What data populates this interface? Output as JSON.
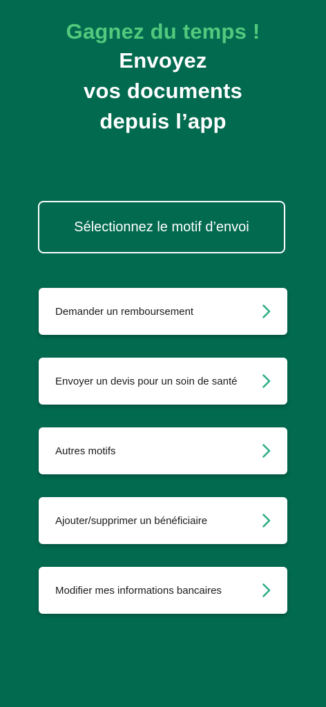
{
  "hero": {
    "accent": "Gagnez du temps !",
    "line1": "Envoyez",
    "line2": "vos documents",
    "line3": "depuis l’app"
  },
  "motif": {
    "label": "Sélectionnez le motif d’envoi"
  },
  "options": [
    {
      "label": "Demander un remboursement",
      "icon": "chevron-right-icon"
    },
    {
      "label": "Envoyer un devis pour un soin de santé",
      "icon": "chevron-right-icon"
    },
    {
      "label": "Autres motifs",
      "icon": "chevron-right-icon"
    },
    {
      "label": "Ajouter/supprimer un bénéficiaire",
      "icon": "chevron-right-icon"
    },
    {
      "label": "Modifier mes informations bancaires",
      "icon": "chevron-right-icon"
    }
  ],
  "colors": {
    "background": "#026a4f",
    "accent": "#52c97d",
    "chevron": "#2eae86"
  }
}
